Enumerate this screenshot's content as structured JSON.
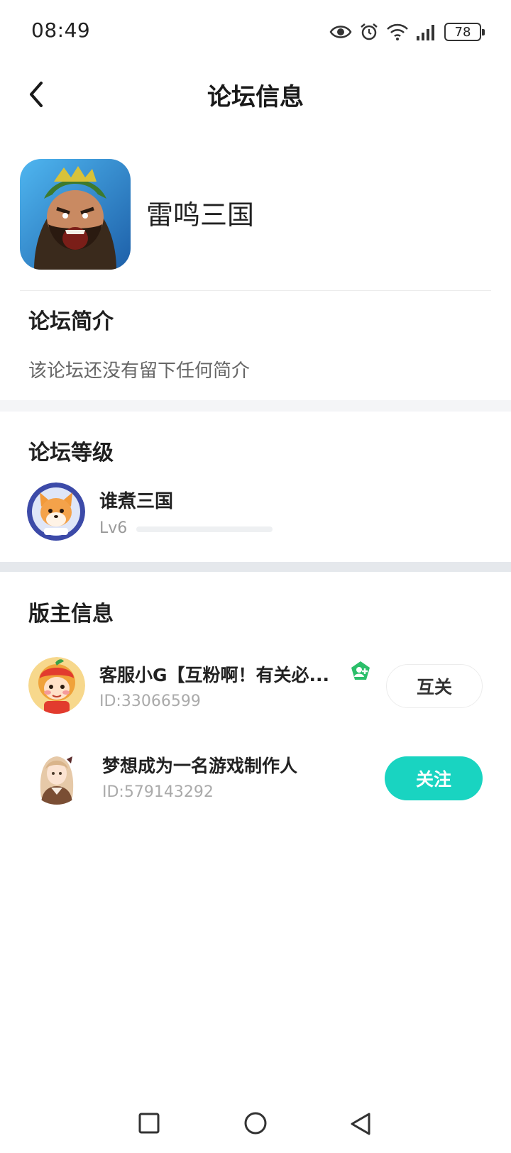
{
  "status_bar": {
    "time": "08:49",
    "battery": "78"
  },
  "header": {
    "title": "论坛信息"
  },
  "forum": {
    "name": "雷鸣三国"
  },
  "intro": {
    "title": "论坛简介",
    "text": "该论坛还没有留下任何简介"
  },
  "level": {
    "title": "论坛等级",
    "name": "谁煮三国",
    "level": "Lv6",
    "progress": 0
  },
  "moderators": {
    "title": "版主信息",
    "items": [
      {
        "name": "客服小G【互粉啊！有关必...",
        "id": "ID:33066599",
        "button": "互关"
      },
      {
        "name": "梦想成为一名游戏制作人",
        "id": "ID:579143292",
        "button": "关注"
      }
    ]
  },
  "colors": {
    "accent": "#19d4c1",
    "badge": "#2bbf6a"
  }
}
